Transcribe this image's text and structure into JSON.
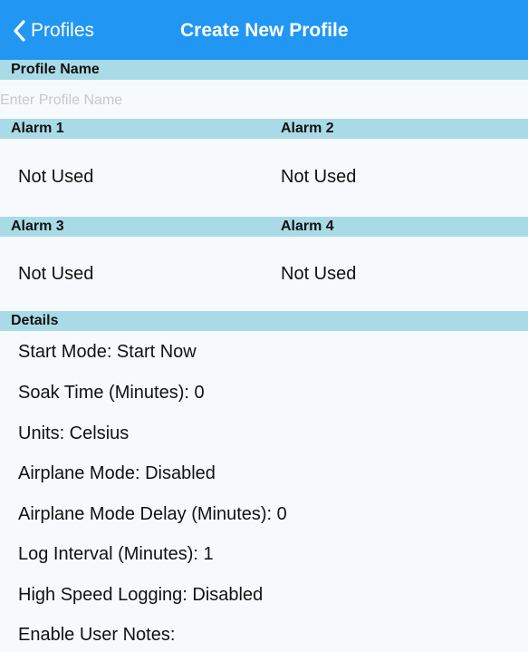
{
  "nav": {
    "back_label": "Profiles",
    "title": "Create New Profile"
  },
  "profile_name": {
    "header": "Profile Name",
    "placeholder": "Enter Profile Name",
    "value": ""
  },
  "alarms": {
    "alarm1": {
      "header": "Alarm 1",
      "value": "Not Used"
    },
    "alarm2": {
      "header": "Alarm 2",
      "value": "Not Used"
    },
    "alarm3": {
      "header": "Alarm 3",
      "value": "Not Used"
    },
    "alarm4": {
      "header": "Alarm 4",
      "value": "Not Used"
    }
  },
  "details": {
    "header": "Details",
    "rows": [
      "Start Mode: Start Now",
      "Soak Time (Minutes): 0",
      "Units: Celsius",
      "Airplane Mode: Disabled",
      "Airplane Mode Delay (Minutes): 0",
      "Log Interval (Minutes): 1",
      "High Speed Logging: Disabled",
      "Enable User Notes:"
    ]
  },
  "colors": {
    "nav_bar": "#2196f3",
    "section_header": "#a9dbe7",
    "background": "#f6fafd",
    "placeholder": "#c6c9cc"
  },
  "icons": {
    "back": "chevron-left-icon"
  }
}
